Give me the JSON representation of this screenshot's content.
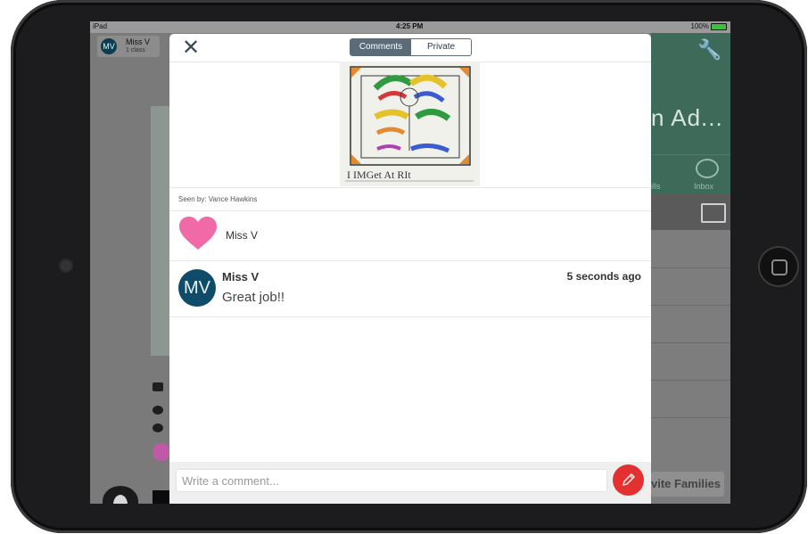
{
  "status_bar": {
    "carrier": "iPad",
    "time": "4:25 PM",
    "battery": "100%"
  },
  "background_app": {
    "teacher_chip": {
      "initials": "MV",
      "name": "Miss V",
      "subtitle": "1 class"
    },
    "class_title_fragment": "n Ad...",
    "tab_labels": [
      "ills",
      "Inbox"
    ],
    "invite_fragment": "vite Families"
  },
  "modal": {
    "close_glyph": "✕",
    "tabs": [
      {
        "label": "Comments",
        "active": true
      },
      {
        "label": "Private Notes",
        "active": false
      }
    ],
    "drawing_caption": "I IMGet At RIt",
    "seen_by": "Seen by: Vance Hawkins",
    "like": {
      "name": "Miss V",
      "heart_color": "#f06aa8"
    },
    "comments": [
      {
        "initials": "MV",
        "author": "Miss V",
        "time": "5 seconds ago",
        "text": "Great job!!"
      }
    ],
    "composer": {
      "placeholder": "Write a comment...",
      "send_icon": "pencil-icon"
    }
  },
  "colors": {
    "accent_green": "#3d6a59",
    "avatar_blue": "#0f4c6a",
    "send_red": "#e33131",
    "segment": "#5b6b78"
  }
}
